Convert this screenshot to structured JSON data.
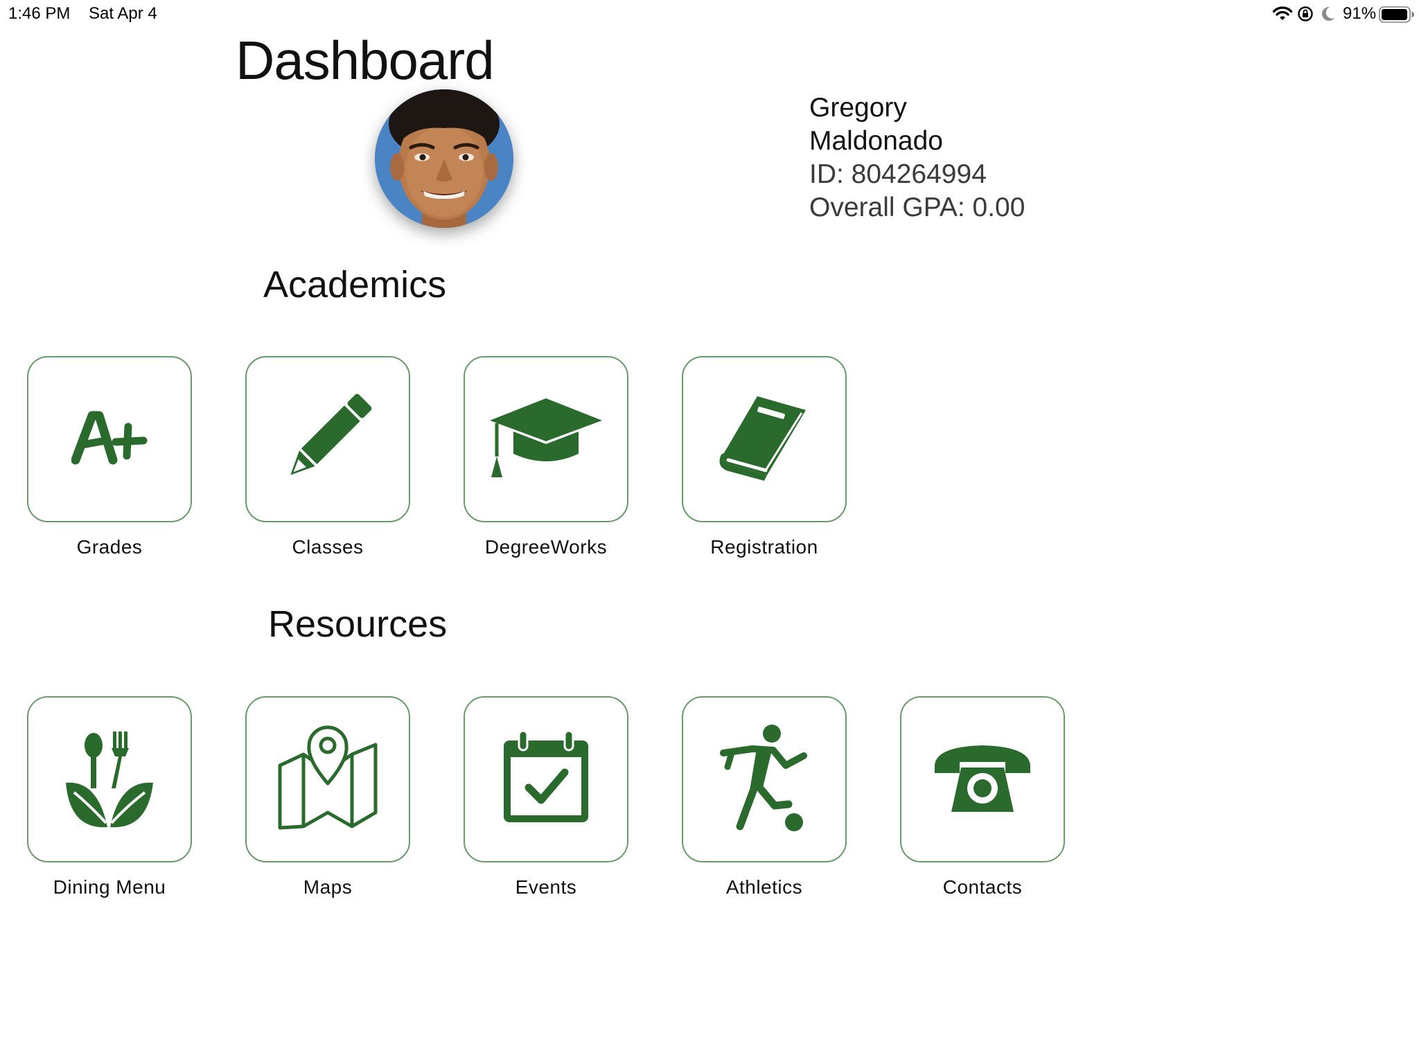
{
  "status_bar": {
    "time": "1:46 PM",
    "date": "Sat Apr 4",
    "battery_percent": "91%",
    "icons": [
      "wifi-icon",
      "lock-rotation-icon",
      "moon-icon",
      "battery-icon"
    ]
  },
  "header": {
    "title": "Dashboard"
  },
  "profile": {
    "first_name": "Gregory",
    "last_name": "Maldonado",
    "id_text": "ID: 804264994",
    "gpa_text": "Overall GPA: 0.00"
  },
  "sections": {
    "academics": {
      "heading": "Academics",
      "items": [
        {
          "label": "Grades",
          "icon": "a-plus-icon"
        },
        {
          "label": "Classes",
          "icon": "pencil-icon"
        },
        {
          "label": "DegreeWorks",
          "icon": "graduation-cap-icon"
        },
        {
          "label": "Registration",
          "icon": "book-icon"
        }
      ]
    },
    "resources": {
      "heading": "Resources",
      "items": [
        {
          "label": "Dining Menu",
          "icon": "dining-icon"
        },
        {
          "label": "Maps",
          "icon": "map-icon"
        },
        {
          "label": "Events",
          "icon": "calendar-check-icon"
        },
        {
          "label": "Athletics",
          "icon": "soccer-player-icon"
        },
        {
          "label": "Contacts",
          "icon": "telephone-icon"
        }
      ]
    }
  },
  "colors": {
    "accent": "#2a6a2c",
    "tile_border": "#6a9a6a",
    "background": "#ffffff"
  }
}
